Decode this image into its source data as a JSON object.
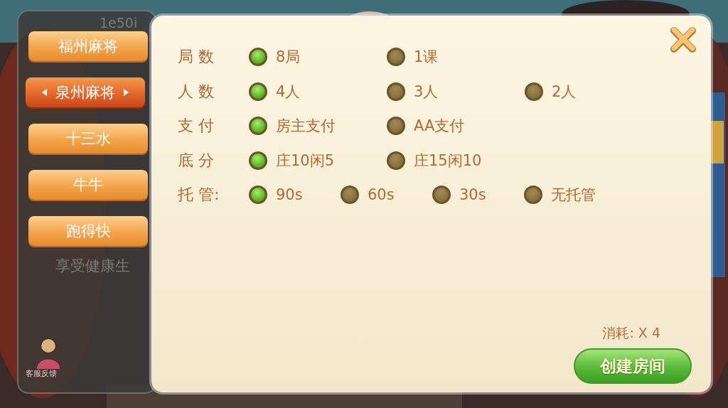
{
  "background_panel": {
    "id_text": "1e50i",
    "slogan": "享受健康生",
    "support_label": "客服反馈"
  },
  "game_tabs": [
    {
      "label": "福州麻将",
      "selected": false
    },
    {
      "label": "泉州麻将",
      "selected": true
    },
    {
      "label": "十三水",
      "selected": false
    },
    {
      "label": "牛牛",
      "selected": false
    },
    {
      "label": "跑得快",
      "selected": false
    }
  ],
  "options": [
    {
      "label": "局 数",
      "choices": [
        {
          "label": "8局",
          "selected": true
        },
        {
          "label": "1课",
          "selected": false
        }
      ]
    },
    {
      "label": "人 数",
      "choices": [
        {
          "label": "4人",
          "selected": true
        },
        {
          "label": "3人",
          "selected": false
        },
        {
          "label": "2人",
          "selected": false
        }
      ]
    },
    {
      "label": "支 付",
      "choices": [
        {
          "label": "房主支付",
          "selected": true
        },
        {
          "label": "AA支付",
          "selected": false
        }
      ]
    },
    {
      "label": "底 分",
      "choices": [
        {
          "label": "庄10闲5",
          "selected": true
        },
        {
          "label": "庄15闲10",
          "selected": false
        }
      ]
    },
    {
      "label": "托 管:",
      "choices": [
        {
          "label": "90s",
          "selected": true
        },
        {
          "label": "60s",
          "selected": false
        },
        {
          "label": "30s",
          "selected": false
        },
        {
          "label": "无托管",
          "selected": false
        }
      ]
    }
  ],
  "cost": "消耗: X 4",
  "create_button": "创建房间"
}
